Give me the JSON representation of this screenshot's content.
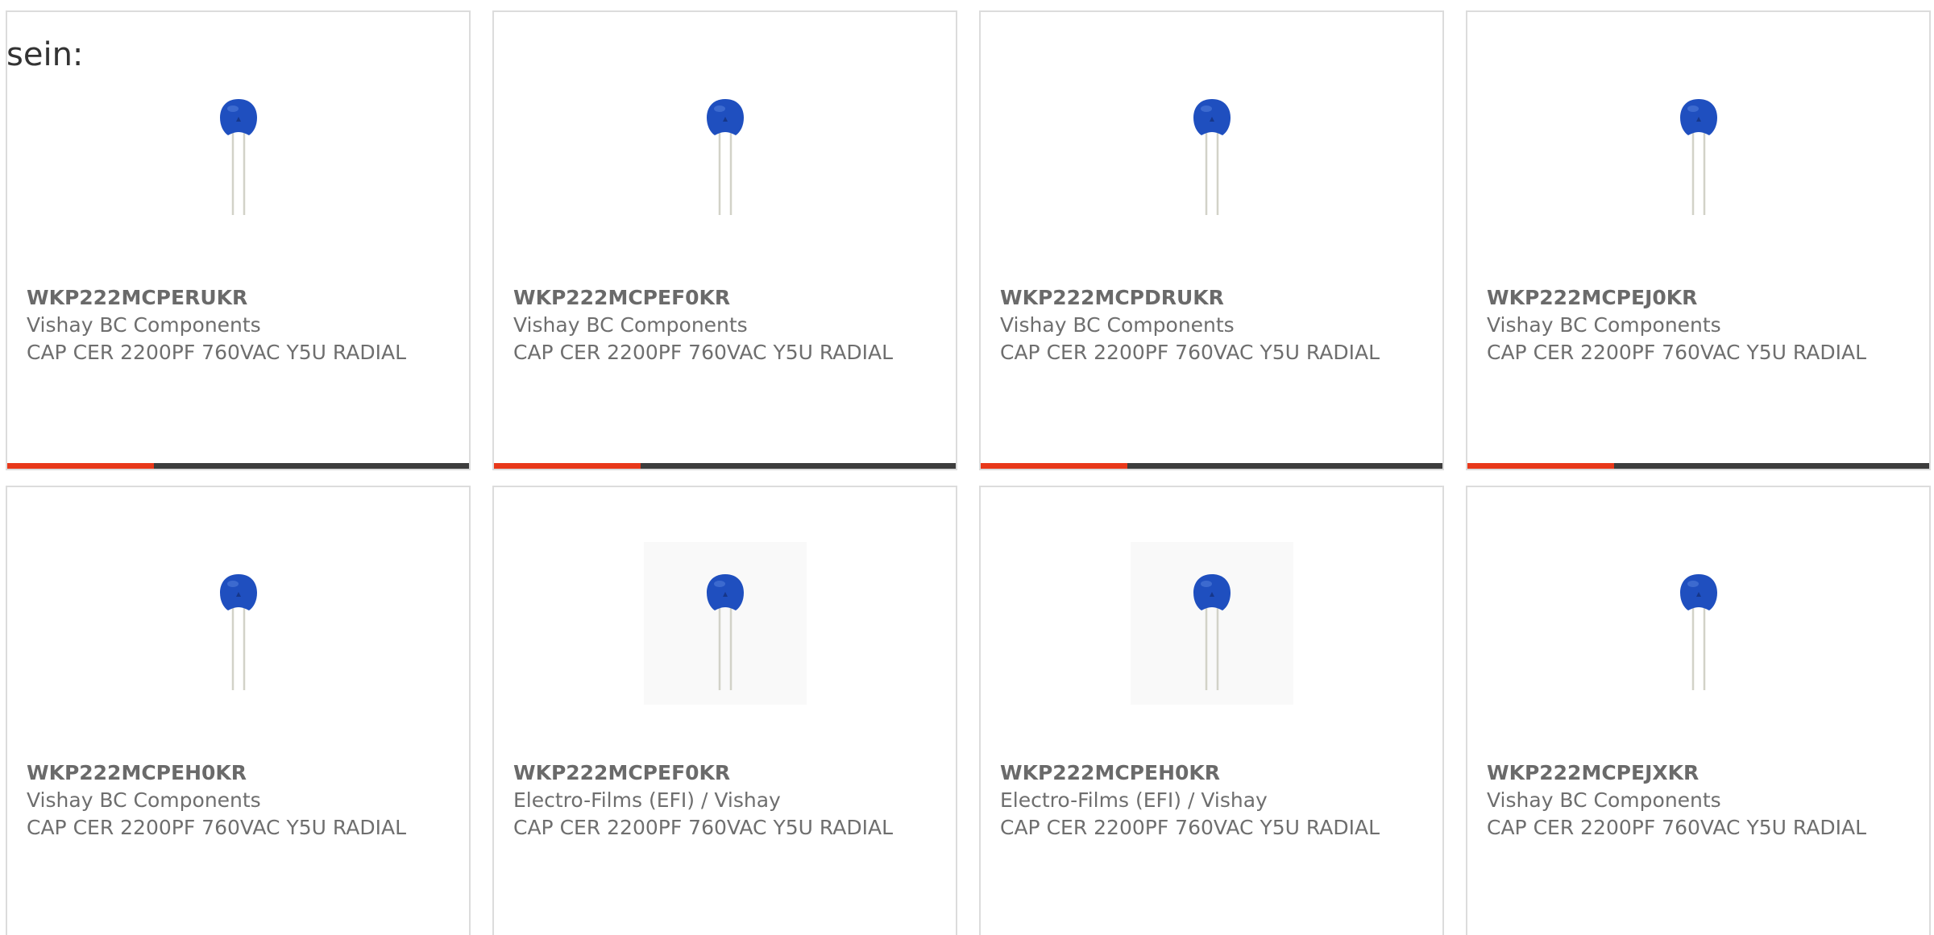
{
  "intro_text": "sein:",
  "colors": {
    "accent": "#e8381a",
    "bar_dark": "#3d3d3d",
    "capacitor_blue": "#1f4fbf"
  },
  "products": [
    {
      "part_number": "WKP222MCPERUKR",
      "manufacturer": "Vishay BC Components",
      "description": "CAP CER 2200PF 760VAC Y5U RADIAL",
      "image_icon": "ceramic-disc-capacitor-icon"
    },
    {
      "part_number": "WKP222MCPEF0KR",
      "manufacturer": "Vishay BC Components",
      "description": "CAP CER 2200PF 760VAC Y5U RADIAL",
      "image_icon": "ceramic-disc-capacitor-icon"
    },
    {
      "part_number": "WKP222MCPDRUKR",
      "manufacturer": "Vishay BC Components",
      "description": "CAP CER 2200PF 760VAC Y5U RADIAL",
      "image_icon": "ceramic-disc-capacitor-icon"
    },
    {
      "part_number": "WKP222MCPEJ0KR",
      "manufacturer": "Vishay BC Components",
      "description": "CAP CER 2200PF 760VAC Y5U RADIAL",
      "image_icon": "ceramic-disc-capacitor-icon"
    },
    {
      "part_number": "WKP222MCPEH0KR",
      "manufacturer": "Vishay BC Components",
      "description": "CAP CER 2200PF 760VAC Y5U RADIAL",
      "image_icon": "ceramic-disc-capacitor-icon"
    },
    {
      "part_number": "WKP222MCPEF0KR",
      "manufacturer": "Electro-Films (EFI) / Vishay",
      "description": "CAP CER 2200PF 760VAC Y5U RADIAL",
      "image_icon": "ceramic-disc-capacitor-icon"
    },
    {
      "part_number": "WKP222MCPEH0KR",
      "manufacturer": "Electro-Films (EFI) / Vishay",
      "description": "CAP CER 2200PF 760VAC Y5U RADIAL",
      "image_icon": "ceramic-disc-capacitor-icon"
    },
    {
      "part_number": "WKP222MCPEJXKR",
      "manufacturer": "Vishay BC Components",
      "description": "CAP CER 2200PF 760VAC Y5U RADIAL",
      "image_icon": "ceramic-disc-capacitor-icon"
    }
  ]
}
